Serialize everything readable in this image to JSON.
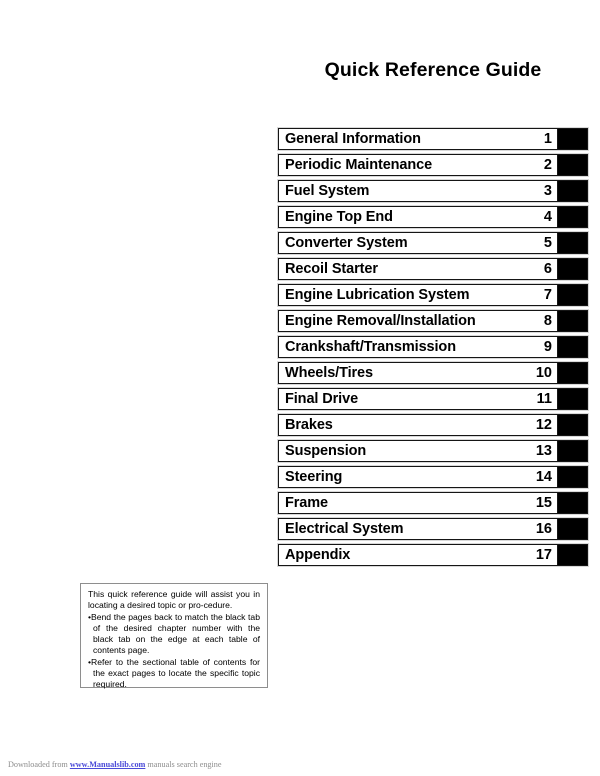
{
  "document": {
    "title": "Quick Reference Guide"
  },
  "chapters": [
    {
      "label": "General Information",
      "number": "1"
    },
    {
      "label": "Periodic Maintenance",
      "number": "2"
    },
    {
      "label": "Fuel System",
      "number": "3"
    },
    {
      "label": "Engine Top End",
      "number": "4"
    },
    {
      "label": "Converter System",
      "number": "5"
    },
    {
      "label": "Recoil Starter",
      "number": "6"
    },
    {
      "label": "Engine Lubrication System",
      "number": "7"
    },
    {
      "label": "Engine Removal/Installation",
      "number": "8"
    },
    {
      "label": "Crankshaft/Transmission",
      "number": "9"
    },
    {
      "label": "Wheels/Tires",
      "number": "10"
    },
    {
      "label": "Final Drive",
      "number": "11"
    },
    {
      "label": "Brakes",
      "number": "12"
    },
    {
      "label": "Suspension",
      "number": "13"
    },
    {
      "label": "Steering",
      "number": "14"
    },
    {
      "label": "Frame",
      "number": "15"
    },
    {
      "label": "Electrical System",
      "number": "16"
    },
    {
      "label": "Appendix",
      "number": "17"
    }
  ],
  "note": {
    "intro": "This quick reference guide will assist you in locating a desired topic or pro-cedure.",
    "bullets": [
      "Bend the pages back to match the black tab of the desired chapter number with the black tab on the edge at each table of contents page.",
      "Refer to the sectional table of contents for the exact pages to locate the specific topic required."
    ],
    "bullet_marker": "•"
  },
  "footer": {
    "prefix": "Downloaded from ",
    "link": "www.Manualslib.com",
    "suffix": " manuals search engine"
  },
  "colors": {
    "tab_black": "#000000",
    "box_border": "#151515",
    "note_border": "#8e8e8e",
    "footer_text": "#8d8d8d",
    "footer_link": "#4a4ad8",
    "page_background": "#ffffff"
  }
}
